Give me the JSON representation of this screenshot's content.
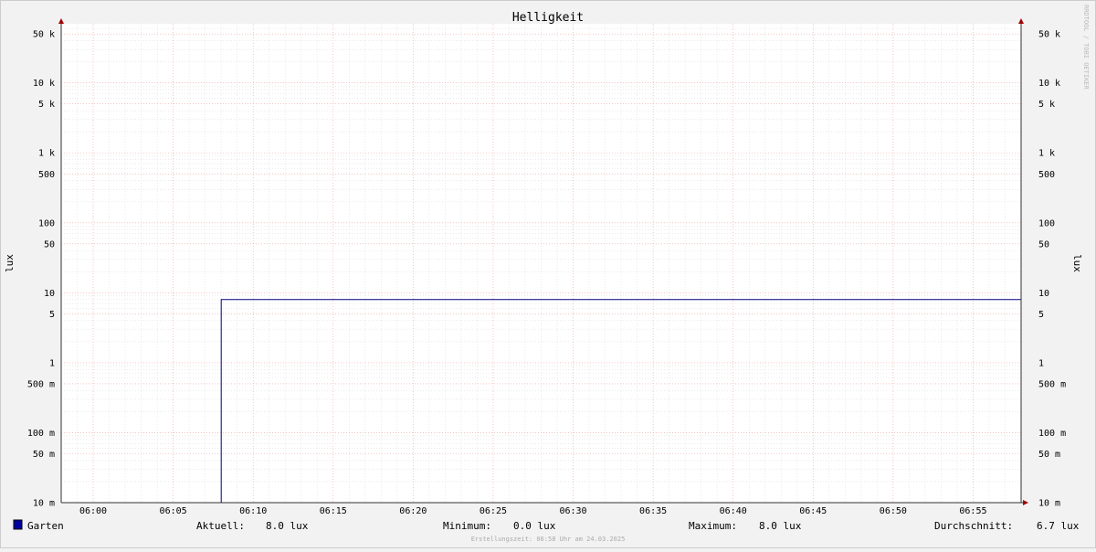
{
  "chart_data": {
    "type": "line",
    "title": "Helligkeit",
    "ylabel": "lux",
    "yscale": "log",
    "ylim": [
      0.01,
      70000
    ],
    "x_ticks": [
      "06:00",
      "06:05",
      "06:10",
      "06:15",
      "06:20",
      "06:25",
      "06:30",
      "06:35",
      "06:40",
      "06:45",
      "06:50",
      "06:55"
    ],
    "xlim": [
      "05:58",
      "06:58"
    ],
    "y_ticks": [
      {
        "value": 50000,
        "label": "50 k"
      },
      {
        "value": 10000,
        "label": "10 k"
      },
      {
        "value": 5000,
        "label": "5 k"
      },
      {
        "value": 1000,
        "label": "1 k"
      },
      {
        "value": 500,
        "label": "500"
      },
      {
        "value": 100,
        "label": "100"
      },
      {
        "value": 50,
        "label": "50"
      },
      {
        "value": 10,
        "label": "10"
      },
      {
        "value": 5,
        "label": "5"
      },
      {
        "value": 1,
        "label": "1"
      },
      {
        "value": 0.5,
        "label": "500 m"
      },
      {
        "value": 0.1,
        "label": "100 m"
      },
      {
        "value": 0.05,
        "label": "50 m"
      },
      {
        "value": 0.01,
        "label": "10 m"
      }
    ],
    "grid": true,
    "series": [
      {
        "name": "Garten",
        "color": "#000080",
        "x": [
          "05:58",
          "06:08",
          "06:08",
          "06:58"
        ],
        "y": [
          0.01,
          0.01,
          8.0,
          8.0
        ]
      }
    ]
  },
  "legend": {
    "series_name": "Garten",
    "swatch_color": "#0000a0",
    "current_label": "Aktuell:",
    "current_value": "8.0 lux",
    "min_label": "Minimum:",
    "min_value": "0.0 lux",
    "max_label": "Maximum:",
    "max_value": "8.0 lux",
    "avg_label": "Durchschnitt:",
    "avg_value": "6.7 lux"
  },
  "footer": "Erstellungszeit: 06:58 Uhr am 24.03.2025",
  "watermark": "RRDTOOL / TOBI OETIKER"
}
